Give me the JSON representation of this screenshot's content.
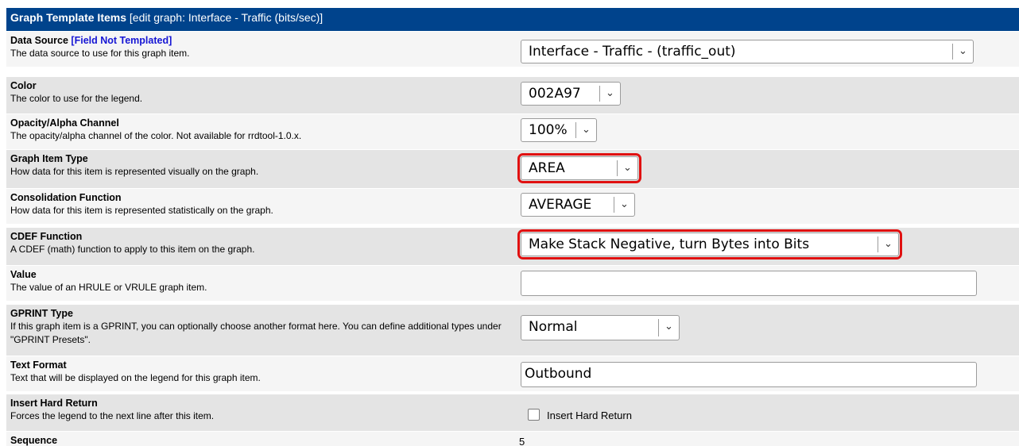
{
  "header": {
    "title": "Graph Template Items",
    "subtitle": " [edit graph: Interface - Traffic (bits/sec)]"
  },
  "fields": {
    "data_source": {
      "title": "Data Source ",
      "not_templated": "[Field Not Templated]",
      "desc": "The data source to use for this graph item.",
      "value": "Interface - Traffic - (traffic_out)"
    },
    "color": {
      "title": "Color",
      "desc": "The color to use for the legend.",
      "value": "002A97"
    },
    "opacity": {
      "title": "Opacity/Alpha Channel",
      "desc": "The opacity/alpha channel of the color. Not available for rrdtool-1.0.x.",
      "value": "100%"
    },
    "item_type": {
      "title": "Graph Item Type",
      "desc": "How data for this item is represented visually on the graph.",
      "value": "AREA"
    },
    "consolidation": {
      "title": "Consolidation Function",
      "desc": "How data for this item is represented statistically on the graph.",
      "value": "AVERAGE"
    },
    "cdef": {
      "title": "CDEF Function",
      "desc": "A CDEF (math) function to apply to this item on the graph.",
      "value": "Make Stack Negative, turn Bytes into Bits"
    },
    "value": {
      "title": "Value",
      "desc": "The value of an HRULE or VRULE graph item.",
      "value": ""
    },
    "gprint": {
      "title": "GPRINT Type",
      "desc": "If this graph item is a GPRINT, you can optionally choose another format here. You can define additional types under \"GPRINT Presets\".",
      "value": "Normal"
    },
    "text_format": {
      "title": "Text Format",
      "desc": "Text that will be displayed on the legend for this graph item.",
      "value": "Outbound"
    },
    "hard_return": {
      "title": "Insert Hard Return",
      "desc": "Forces the legend to the next line after this item.",
      "checkbox_label": "Insert Hard Return",
      "checked": false
    },
    "sequence": {
      "title": "Sequence",
      "value": "5"
    }
  },
  "icons": {
    "dropdown": "chevron-down-icon"
  },
  "colors": {
    "header_bg": "#00438c",
    "highlight": "#e01010",
    "not_templated_link": "#1515d4"
  }
}
